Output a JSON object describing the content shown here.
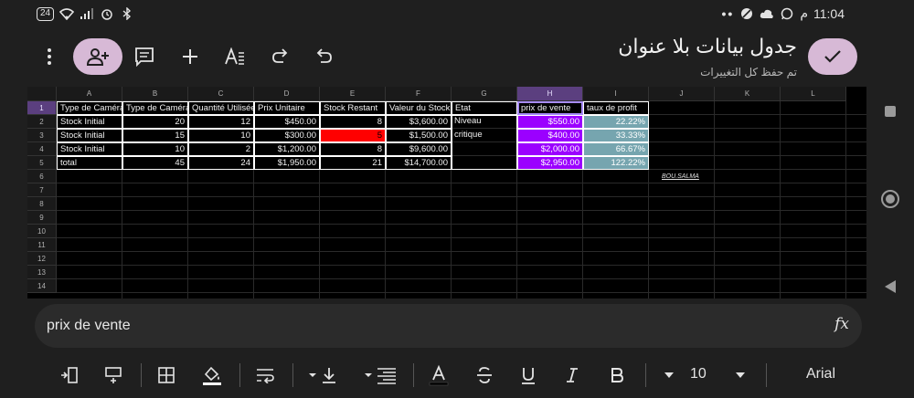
{
  "status": {
    "battery": "24",
    "time": "11:04",
    "time_suffix": "م",
    "overflow": "••"
  },
  "doc": {
    "title": "جدول بيانات بلا عنوان",
    "subtitle": "تم حفظ كل التغييرات"
  },
  "sheet": {
    "columns": [
      "A",
      "B",
      "C",
      "D",
      "E",
      "F",
      "G",
      "H",
      "I",
      "J",
      "K",
      "L"
    ],
    "rows": [
      "1",
      "2",
      "3",
      "4",
      "5",
      "6",
      "7",
      "8",
      "9",
      "10",
      "11",
      "12",
      "13",
      "14"
    ],
    "selected_column": "H",
    "selected_row": "1",
    "headers": [
      "Type de Caméra",
      "Type de Caméra",
      "Quantité Utilisée",
      "Prix Unitaire",
      "Stock Restant",
      "Valeur du Stock",
      "Etat",
      "prix de vente",
      "taux de profit"
    ],
    "data": [
      [
        "Stock Initial",
        "20",
        "12",
        "$450.00",
        "8",
        "$3,600.00",
        "Niveau",
        "$550.00",
        "22.22%"
      ],
      [
        "Stock Initial",
        "15",
        "10",
        "$300.00",
        "5",
        "$1,500.00",
        "critique",
        "$400.00",
        "33.33%"
      ],
      [
        "Stock Initial",
        "10",
        "2",
        "$1,200.00",
        "8",
        "$9,600.00",
        "",
        "$2,000.00",
        "66.67%"
      ],
      [
        "total",
        "45",
        "24",
        "$1,950.00",
        "21",
        "$14,700.00",
        "",
        "$2,950.00",
        "122.22%"
      ]
    ],
    "signature": "BOU.SALMA"
  },
  "formula_bar": {
    "value": "prix de vente",
    "fx": "fx"
  },
  "toolbar": {
    "font_size": "10",
    "font_name": "Arial"
  },
  "colors": {
    "red": "#ff0000",
    "purple": "#9b00ff",
    "teal": "#76a5af",
    "accent": "#d7b9d6"
  }
}
